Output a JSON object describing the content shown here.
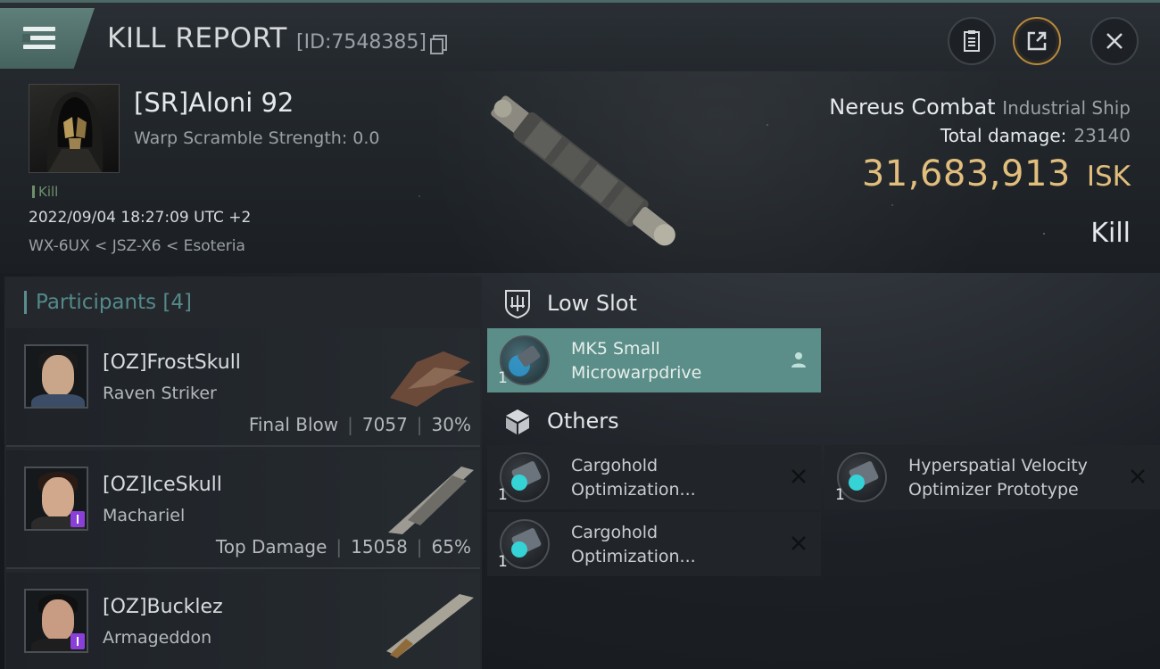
{
  "header": {
    "title": "KILL REPORT",
    "report_id": "[ID:7548385]"
  },
  "victim": {
    "name": "[SR]Aloni 92",
    "warp_scramble": "Warp Scramble Strength: 0.0",
    "tag": "Kill",
    "datetime": "2022/09/04 18:27:09 UTC +2",
    "route": "WX-6UX < JSZ-X6 < Esoteria",
    "ship_name": "Nereus Combat",
    "ship_class": "Industrial Ship",
    "total_damage_label": "Total damage:",
    "total_damage": "23140",
    "isk_amount": "31,683,913",
    "isk_unit": "ISK",
    "status": "Kill"
  },
  "participants": {
    "label": "Participants",
    "count": "[4]",
    "items": [
      {
        "name": "[OZ]FrostSkull",
        "ship": "Raven Striker",
        "role": "Final Blow",
        "damage": "7057",
        "percent": "30%"
      },
      {
        "name": "[OZ]IceSkull",
        "ship": "Machariel",
        "role": "Top Damage",
        "damage": "15058",
        "percent": "65%"
      },
      {
        "name": "[OZ]Bucklez",
        "ship": "Armageddon",
        "role": "",
        "damage": "",
        "percent": ""
      }
    ]
  },
  "fitting": {
    "low_slot_label": "Low Slot",
    "others_label": "Others",
    "low_slot": [
      {
        "name": "MK5 Small Microwarpdrive",
        "qty": "1"
      }
    ],
    "others": [
      {
        "name": "Cargohold Optimization...",
        "qty": "1"
      },
      {
        "name": "Hyperspatial Velocity Optimizer Prototype",
        "qty": "1"
      },
      {
        "name": "Cargohold Optimization...",
        "qty": "1"
      }
    ]
  },
  "colors": {
    "accent_teal": "#5b8e88",
    "isk_gold": "#e2be7d",
    "kill_green": "#6f8f6a"
  }
}
